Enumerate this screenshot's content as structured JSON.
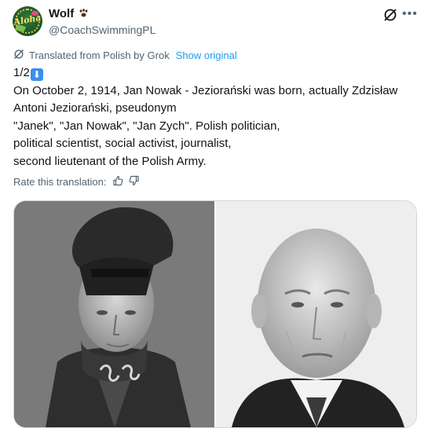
{
  "author": {
    "display_name": "Wolf",
    "handle": "@CoachSwimmingPL",
    "avatar_text": "Aloha",
    "name_badge_icon": "paw-prints-icon"
  },
  "header_icons": [
    "grok-icon",
    "more-options-icon"
  ],
  "translation": {
    "note": "Translated from Polish by Grok",
    "show_original": "Show original"
  },
  "post": {
    "counter": "1/2",
    "counter_icon": "down-arrow-emoji",
    "lines": [
      "On October 2, 1914, Jan Nowak - Jeziorański was born, actually Zdzisław",
      "Antoni Jeziorański, pseudonym",
      "\"Janek\", \"Jan Nowak\", \"Jan Zych\". Polish politician,",
      "political scientist, social activist, journalist,",
      "second lieutenant of the Polish Army."
    ]
  },
  "rating": {
    "label": "Rate this translation:",
    "icons": [
      "thumbs-up-icon",
      "thumbs-down-icon"
    ]
  },
  "media": {
    "images": [
      {
        "description": "young-man-military-uniform-photo"
      },
      {
        "description": "elderly-man-portrait-photo"
      }
    ]
  },
  "colors": {
    "text": "#0f1419",
    "secondary": "#536471",
    "link": "#1d9bf0",
    "arrow_badge": "#3b8ef0",
    "border": "#cfd9de"
  }
}
